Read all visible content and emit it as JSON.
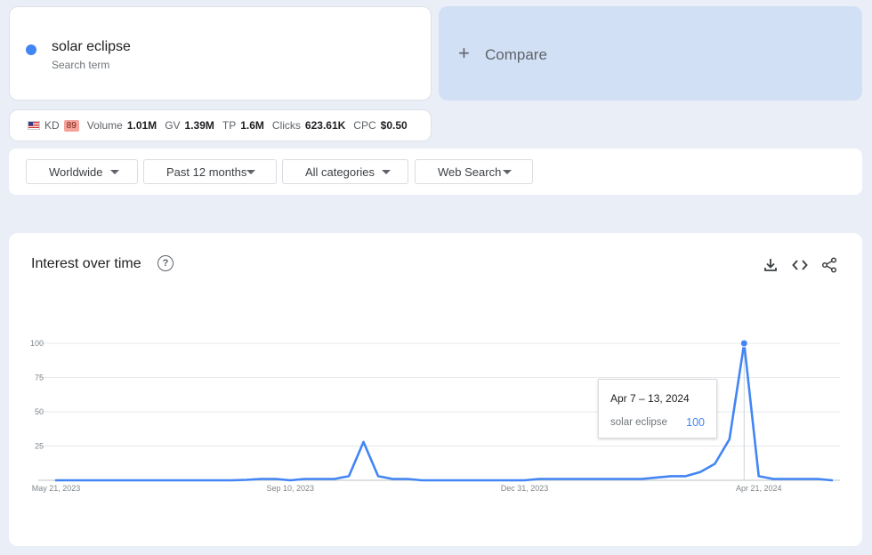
{
  "search_term": {
    "name": "solar eclipse",
    "subtitle": "Search term",
    "color": "#4285f4"
  },
  "compare": {
    "label": "Compare"
  },
  "metrics": {
    "kd_label": "KD",
    "kd_value": "89",
    "volume_label": "Volume",
    "volume_value": "1.01M",
    "gv_label": "GV",
    "gv_value": "1.39M",
    "tp_label": "TP",
    "tp_value": "1.6M",
    "clicks_label": "Clicks",
    "clicks_value": "623.61K",
    "cpc_label": "CPC",
    "cpc_value": "$0.50"
  },
  "filters": {
    "region": "Worldwide",
    "time": "Past 12 months",
    "category": "All categories",
    "search_type": "Web Search"
  },
  "chart_card": {
    "title": "Interest over time"
  },
  "tooltip": {
    "date": "Apr 7 – 13, 2024",
    "term": "solar eclipse",
    "value": "100"
  },
  "chart_data": {
    "type": "line",
    "title": "Interest over time",
    "y_ticks": [
      25,
      50,
      75,
      100
    ],
    "ylim": [
      0,
      100
    ],
    "x_tick_labels": [
      "May 21, 2023",
      "Sep 10, 2023",
      "Dec 31, 2023",
      "Apr 21, 2024"
    ],
    "x_tick_weeks": [
      0,
      16,
      32,
      48
    ],
    "grid": true,
    "series": [
      {
        "name": "solar eclipse",
        "color": "#4285f4",
        "values": [
          0,
          0,
          0,
          0,
          0,
          0,
          0,
          0,
          0,
          0,
          0,
          0,
          0,
          0.3,
          1,
          1,
          0,
          1,
          1,
          1,
          3,
          28,
          3,
          1,
          1,
          0,
          0,
          0,
          0,
          0,
          0,
          0,
          0,
          1,
          1,
          1,
          1,
          1,
          1,
          1,
          1,
          2,
          3,
          3,
          6,
          12,
          30,
          100,
          3,
          1,
          1,
          1,
          1,
          0
        ]
      }
    ],
    "highlight_index": 47
  }
}
